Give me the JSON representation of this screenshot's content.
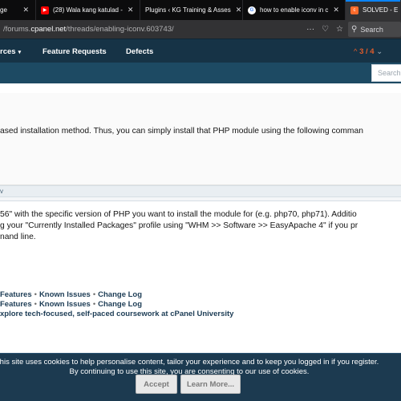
{
  "browser": {
    "tabs": [
      {
        "title": "ge",
        "icon": "page-icon",
        "active": false
      },
      {
        "title": "(28) Wala kang katulad - ",
        "icon": "youtube-icon",
        "active": false
      },
      {
        "title": "Plugins ‹ KG Training & Asses",
        "icon": "wordpress-icon",
        "active": false
      },
      {
        "title": "how to enable iconv in c",
        "icon": "google-icon",
        "active": false
      },
      {
        "title": "SOLVED - E",
        "icon": "cpanel-icon",
        "active": true
      }
    ],
    "url_prefix": "/forums.",
    "url_host": "cpanel.net",
    "url_path": "/threads/enabling-iconv.603743/",
    "search_placeholder": "Search",
    "colors": {
      "accent": "#0a84ff",
      "tabstrip": "#0c0c0d"
    }
  },
  "forum": {
    "nav": {
      "resources": "rces",
      "feature_requests": "Feature Requests",
      "defects": "Defects"
    },
    "counter": {
      "up": "^",
      "value": "3 / 4"
    },
    "search_placeholder": "Search",
    "colors": {
      "nav_bg": "#163346",
      "subnav_bg": "#1d4a63",
      "accent": "#e25c2a"
    }
  },
  "post": {
    "line1": "ased installation method. Thus, you can simply install that PHP module using the following comman",
    "code_label": "v",
    "line2": "56\" with the specific version of PHP you want to install the module for (e.g. php70, php71). Additio",
    "line3": "g your \"Currently Installed Packages\" profile using \"WHM >> Software >> EasyApache 4\" if you pr",
    "line4": "nand line."
  },
  "footer_links": {
    "row1": [
      "Features",
      "Known Issues",
      "Change Log"
    ],
    "row2": [
      "Features",
      "Known Issues",
      "Change Log"
    ],
    "separator": "•",
    "university": "xplore tech-focused, self-paced coursework at cPanel University"
  },
  "cookie_notice": {
    "line1": "his site uses cookies to help personalise content, tailor your experience and to keep you logged in if you register.",
    "line2": "By continuing to use this site, you are consenting to our use of cookies.",
    "accept_label": "Accept",
    "learn_more_label": "Learn More..."
  }
}
